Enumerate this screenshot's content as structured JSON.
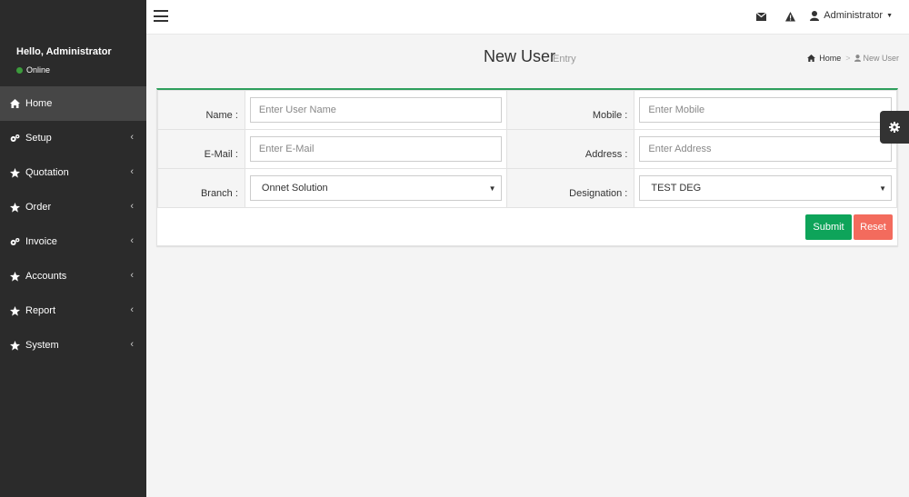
{
  "user_panel": {
    "greeting": "Hello, Administrator",
    "status": "Online"
  },
  "sidebar": {
    "items": [
      {
        "label": "Home",
        "icon": "home-icon",
        "active": true,
        "has_children": false
      },
      {
        "label": "Setup",
        "icon": "gears-icon",
        "has_children": true
      },
      {
        "label": "Quotation",
        "icon": "star-icon",
        "has_children": true
      },
      {
        "label": "Order",
        "icon": "star-icon",
        "has_children": true
      },
      {
        "label": "Invoice",
        "icon": "gears-icon",
        "has_children": true
      },
      {
        "label": "Accounts",
        "icon": "star-icon",
        "has_children": true
      },
      {
        "label": "Report",
        "icon": "star-icon",
        "has_children": true
      },
      {
        "label": "System",
        "icon": "star-icon",
        "has_children": true
      }
    ]
  },
  "header": {
    "user_name": "Administrator",
    "icons": [
      "menu-icon",
      "envelope-icon",
      "warning-icon",
      "user-icon"
    ]
  },
  "content_header": {
    "title": "New User",
    "subtitle": "Entry",
    "breadcrumb": [
      {
        "label": "Home",
        "icon": "home-icon"
      },
      {
        "label": "New User",
        "icon": "user-icon"
      }
    ]
  },
  "form": {
    "name_label": "Name :",
    "name_placeholder": "Enter User Name",
    "mobile_label": "Mobile :",
    "mobile_placeholder": "Enter Mobile",
    "email_label": "E-Mail :",
    "email_placeholder": "Enter E-Mail",
    "address_label": "Address :",
    "address_placeholder": "Enter Address",
    "branch_label": "Branch :",
    "branch_value": "Onnet Solution",
    "designation_label": "Designation :",
    "designation_value": "TEST DEG",
    "submit_label": "Submit",
    "reset_label": "Reset"
  },
  "colors": {
    "sidebar_bg": "#2b2b2b",
    "box_accent": "#2e9f5c",
    "submit": "#0ea45a",
    "reset": "#f36b5d",
    "online": "#3c9b3c"
  }
}
